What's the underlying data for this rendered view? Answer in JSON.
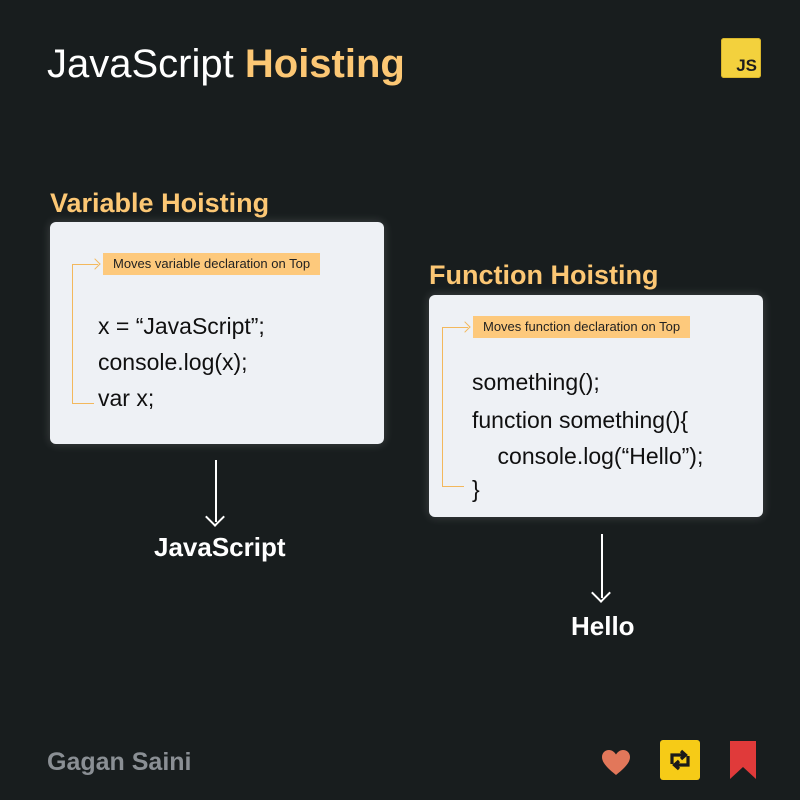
{
  "header": {
    "title_plain": "JavaScript",
    "title_highlight": "Hoisting",
    "badge_text": "JS"
  },
  "variable_section": {
    "title": "Variable Hoisting",
    "badge": "Moves variable declaration on Top",
    "code_lines": [
      "x = “JavaScript”;",
      "console.log(x);",
      "var x;"
    ],
    "output": "JavaScript"
  },
  "function_section": {
    "title": "Function Hoisting",
    "badge": "Moves function declaration on Top",
    "code_lines": [
      "something();",
      "function something(){",
      "    console.log(“Hello”);",
      "}"
    ],
    "output": "Hello"
  },
  "footer": {
    "author": "Gagan Saini",
    "icons": [
      "heart-icon",
      "repost-icon",
      "bookmark-icon"
    ]
  },
  "colors": {
    "background": "#181d1e",
    "accent": "#fcc774",
    "card": "#eef1f5",
    "js_badge": "#f3d13d",
    "heart": "#e2775a",
    "bookmark": "#e03a3a"
  }
}
